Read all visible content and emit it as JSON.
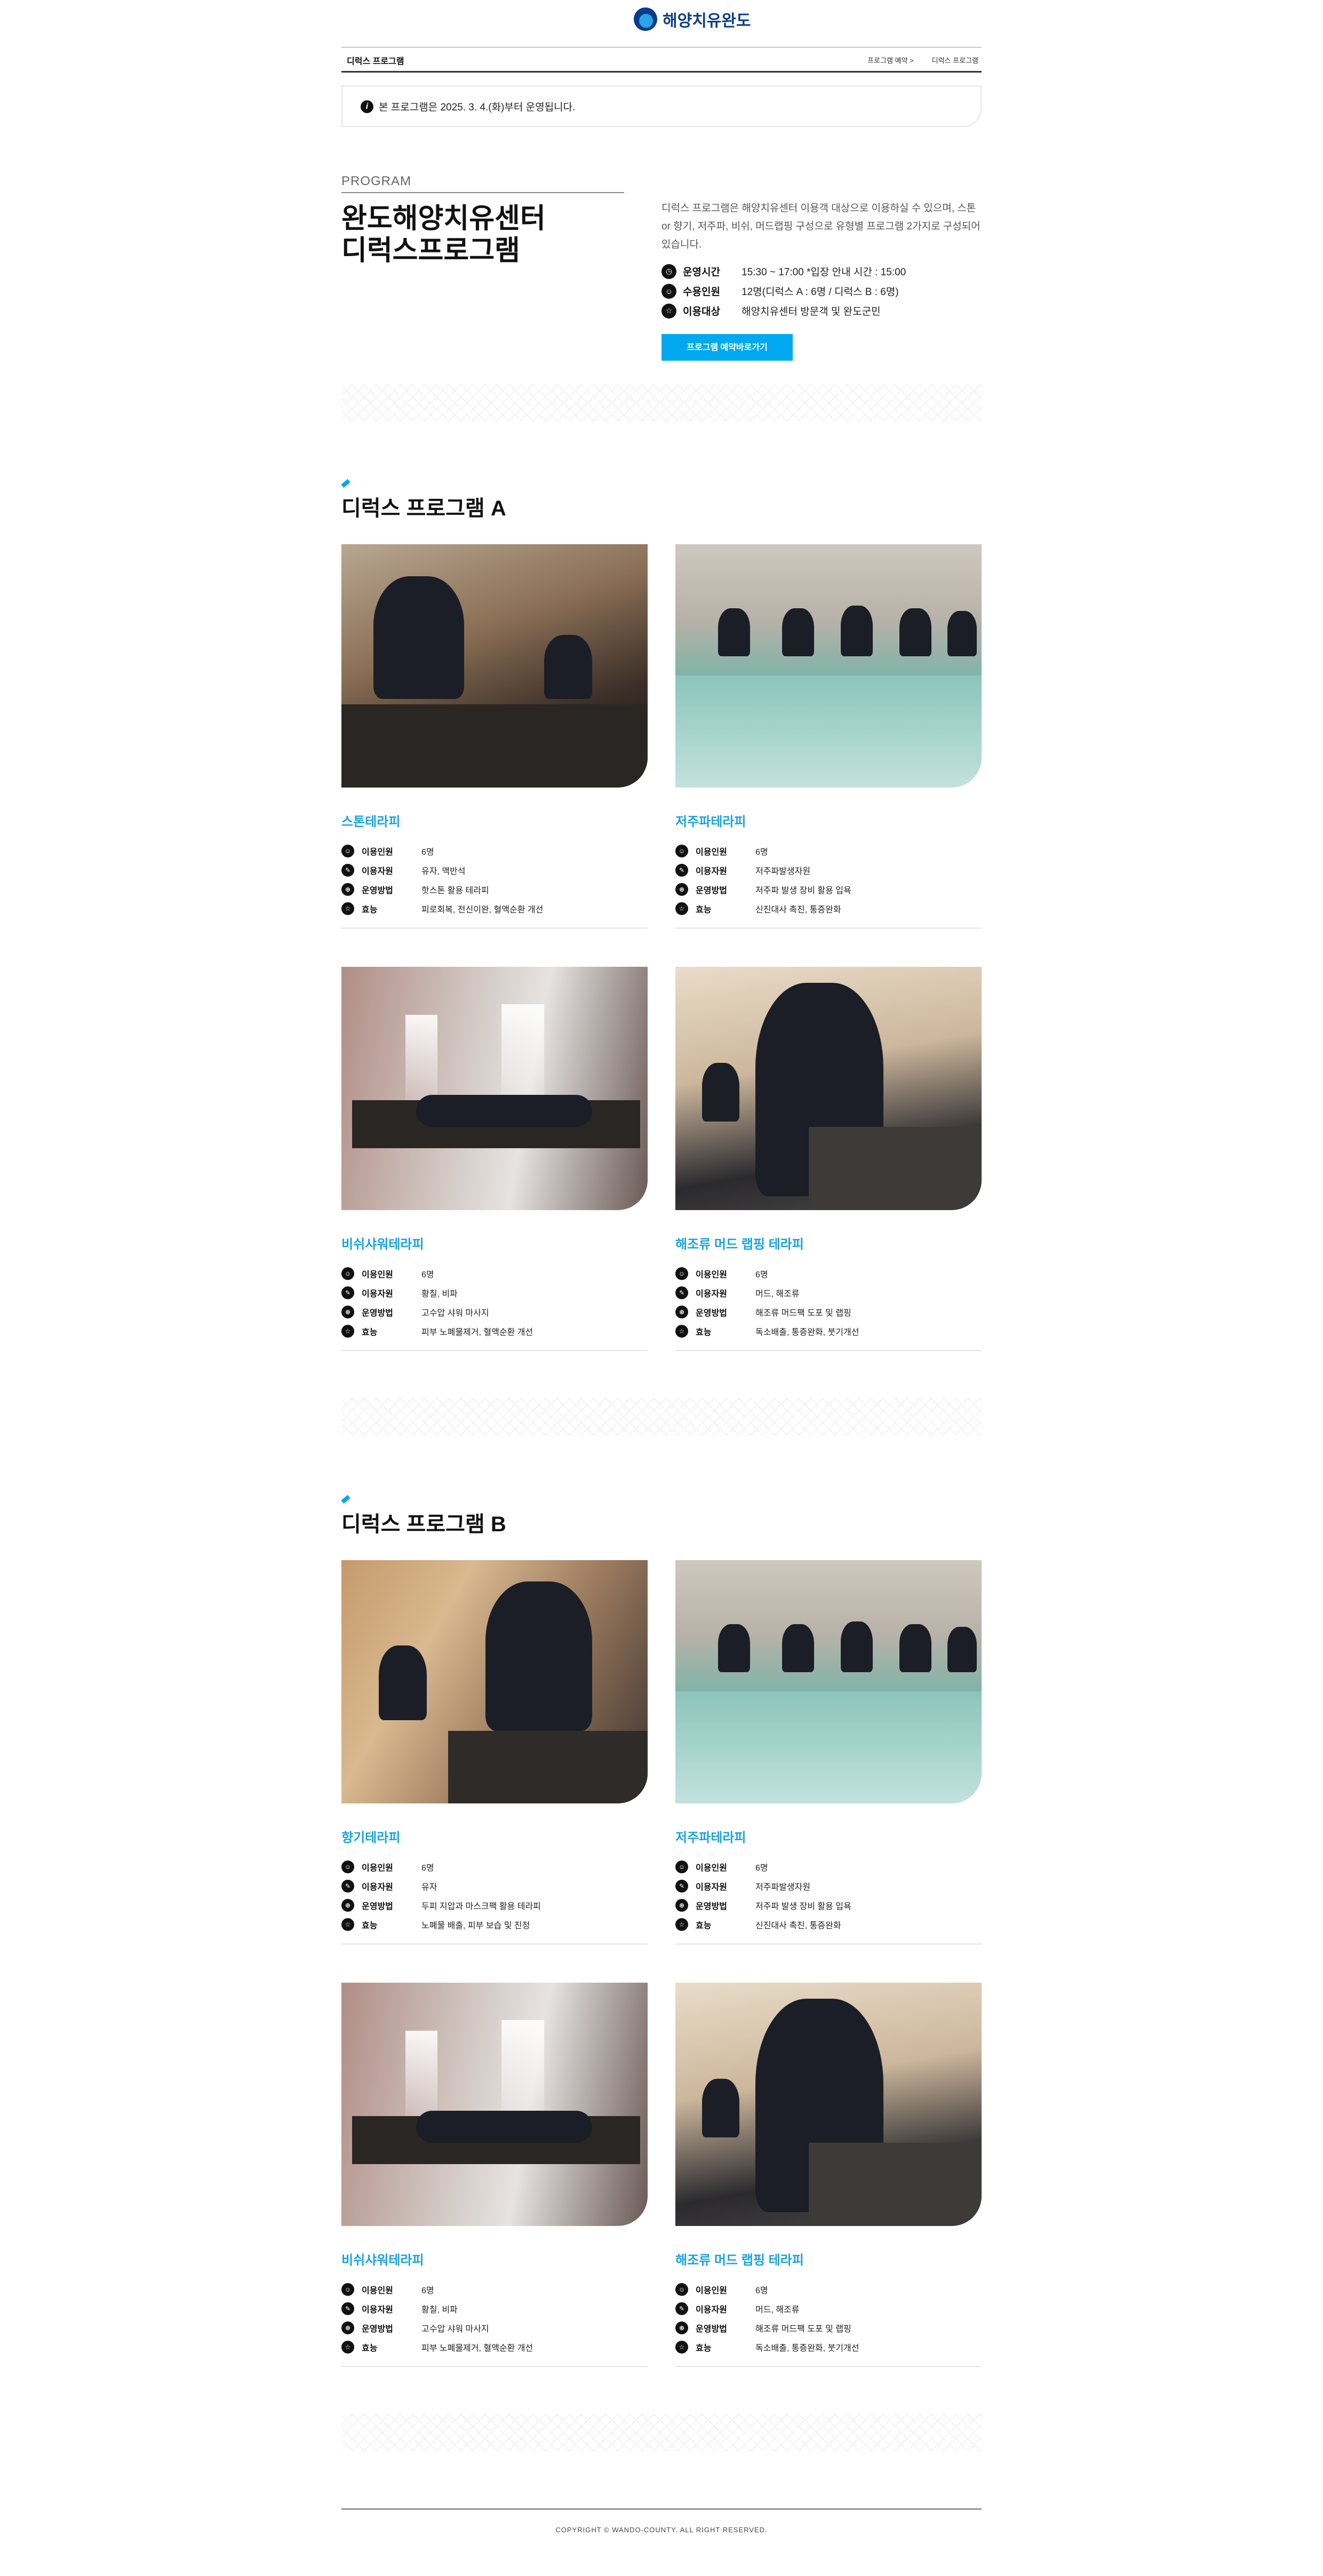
{
  "header": {
    "logo_text": "해양치유완도",
    "nav_title": "디럭스 프로그램",
    "nav_links": [
      "프로그램 예약 >",
      "디럭스 프로그램"
    ]
  },
  "notice": {
    "text": "본 프로그램은 2025. 3. 4.(화)부터 운영됩니다."
  },
  "intro": {
    "label": "PROGRAM",
    "title_line1": "완도해양치유센터",
    "title_line2": "디럭스프로그램",
    "description": "디럭스 프로그램은 해양치유센터 이용객 대상으로 이용하실 수 있으며, 스톤 or 향기, 저주파, 비쉬, 머드랩핑 구성으로 유형별 프로그램 2가지로 구성되어 있습니다.",
    "rows": [
      {
        "key": "운영시간",
        "value": "15:30 ~ 17:00 *입장 안내 시간 : 15:00",
        "icon": "clock-icon"
      },
      {
        "key": "수용인원",
        "value": "12명(디럭스 A : 6명 / 디럭스 B : 6명)",
        "icon": "person-icon"
      },
      {
        "key": "이용대상",
        "value": "해양치유센터 방문객 및 완도군민",
        "icon": "star-icon"
      }
    ],
    "button": "프로그램 예약바로가기"
  },
  "spec_keys": [
    "이용인원",
    "이용자원",
    "운영방법",
    "효능"
  ],
  "sections": [
    {
      "title": "디럭스 프로그램 A",
      "cards": [
        {
          "title": "스톤테라피",
          "photo": "massage",
          "values": [
            "6명",
            "유자, 맥반석",
            "핫스톤 활용 테라피",
            "피로회복, 전신이완, 혈액순환 개선"
          ]
        },
        {
          "title": "저주파테라피",
          "photo": "pool",
          "values": [
            "6명",
            "저주파발생자원",
            "저주파 발생 장비 활용 입욕",
            "신진대사 촉진, 통증완화"
          ]
        },
        {
          "title": "비쉬샤워테라피",
          "photo": "shower",
          "values": [
            "6명",
            "황칠, 비파",
            "고수압 샤워 마사지",
            "피부 노폐물제거, 혈액순환 개선"
          ]
        },
        {
          "title": "해조류 머드 랩핑 테라피",
          "photo": "mud",
          "values": [
            "6명",
            "머드, 해조류",
            "해조류 머드팩 도포 및 랩핑",
            "독소배출, 통증완화, 붓기개선"
          ]
        }
      ]
    },
    {
      "title": "디럭스 프로그램 B",
      "cards": [
        {
          "title": "향기테라피",
          "photo": "aroma",
          "values": [
            "6명",
            "유자",
            "두피 지압과 마스크팩 활용 테라피",
            "노폐물 배출, 피부 보습 및 진정"
          ]
        },
        {
          "title": "저주파테라피",
          "photo": "pool",
          "values": [
            "6명",
            "저주파발생자원",
            "저주파 발생 장비 활용 입욕",
            "신진대사 촉진, 통증완화"
          ]
        },
        {
          "title": "비쉬샤워테라피",
          "photo": "shower",
          "values": [
            "6명",
            "황칠, 비파",
            "고수압 샤워 마사지",
            "피부 노폐물제거, 혈액순환 개선"
          ]
        },
        {
          "title": "해조류 머드 랩핑 테라피",
          "photo": "mud",
          "values": [
            "6명",
            "머드, 해조류",
            "해조류 머드팩 도포 및 랩핑",
            "독소배출, 통증완화, 붓기개선"
          ]
        }
      ]
    }
  ],
  "footer": {
    "copyright": "COPYRIGHT © WANDO-COUNTY. ALL RIGHT RESERVED."
  },
  "colors": {
    "accent": "#00a9ef",
    "card_title": "#18a3df",
    "brand": "#0a3c8a"
  }
}
